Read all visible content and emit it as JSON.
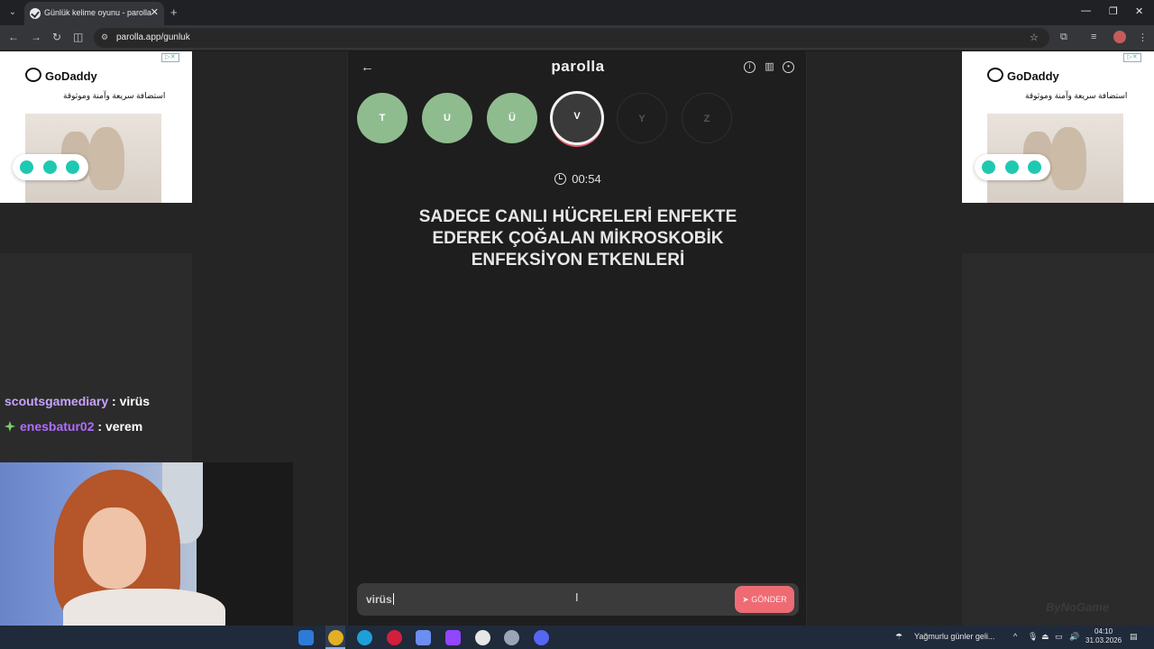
{
  "browser": {
    "tab_title": "Günlük kelime oyunu - parolla",
    "url": "parolla.app/gunluk"
  },
  "ads": {
    "brand": "GoDaddy",
    "tagline": "استضافة سريعة وآمنة وموثوقة"
  },
  "chat": [
    {
      "user": "scoutsgamediary",
      "message": "virüs"
    },
    {
      "user": "enesbatur02",
      "message": "verem"
    }
  ],
  "app": {
    "logo": "parolla",
    "letters": [
      {
        "char": "T",
        "state": "done"
      },
      {
        "char": "U",
        "state": "done"
      },
      {
        "char": "Ü",
        "state": "done"
      },
      {
        "char": "V",
        "state": "active"
      },
      {
        "char": "Y",
        "state": "pending"
      },
      {
        "char": "Z",
        "state": "pending"
      }
    ],
    "timer": "00:54",
    "question": "SADECE CANLI HÜCRELERİ ENFEKTE EDEREK ÇOĞALAN MİKROSKOBİK ENFEKSİYON ETKENLERİ",
    "answer_value": "virüs",
    "send_label": "GÖNDER"
  },
  "watermark": "ByNoGame",
  "taskbar": {
    "weather": "Yağmurlu günler geli...",
    "time": "04:10",
    "date": "31.03.2026"
  },
  "colors": {
    "done": "#8fbc8f",
    "active_ring": "#e25d6b",
    "send_button": "#ef6b74"
  }
}
